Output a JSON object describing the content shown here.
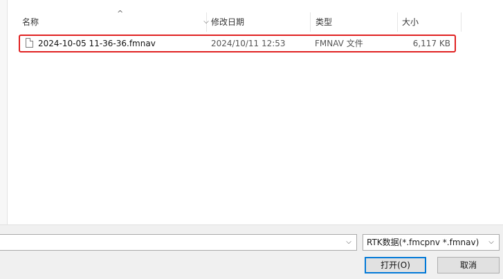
{
  "columns": {
    "name": "名称",
    "date": "修改日期",
    "type": "类型",
    "size": "大小"
  },
  "icons": {
    "sort": "sort-ascending-icon",
    "column_menu": "chevron-down-icon",
    "file": "file-icon"
  },
  "file": {
    "name": "2024-10-05 11-36-36.fmnav",
    "date": "2024/10/11 12:53",
    "type": "FMNAV 文件",
    "size": "6,117 KB"
  },
  "bottom": {
    "filename_value": "",
    "filter_selected": "RTK数据(*.fmcpnv *.fmnav)",
    "open_label": "打开(O)",
    "cancel_label": "取消"
  },
  "colors": {
    "highlight_border": "#e02020",
    "sorted_header": "#d9ebf9",
    "default_button_border": "#0078d7"
  }
}
